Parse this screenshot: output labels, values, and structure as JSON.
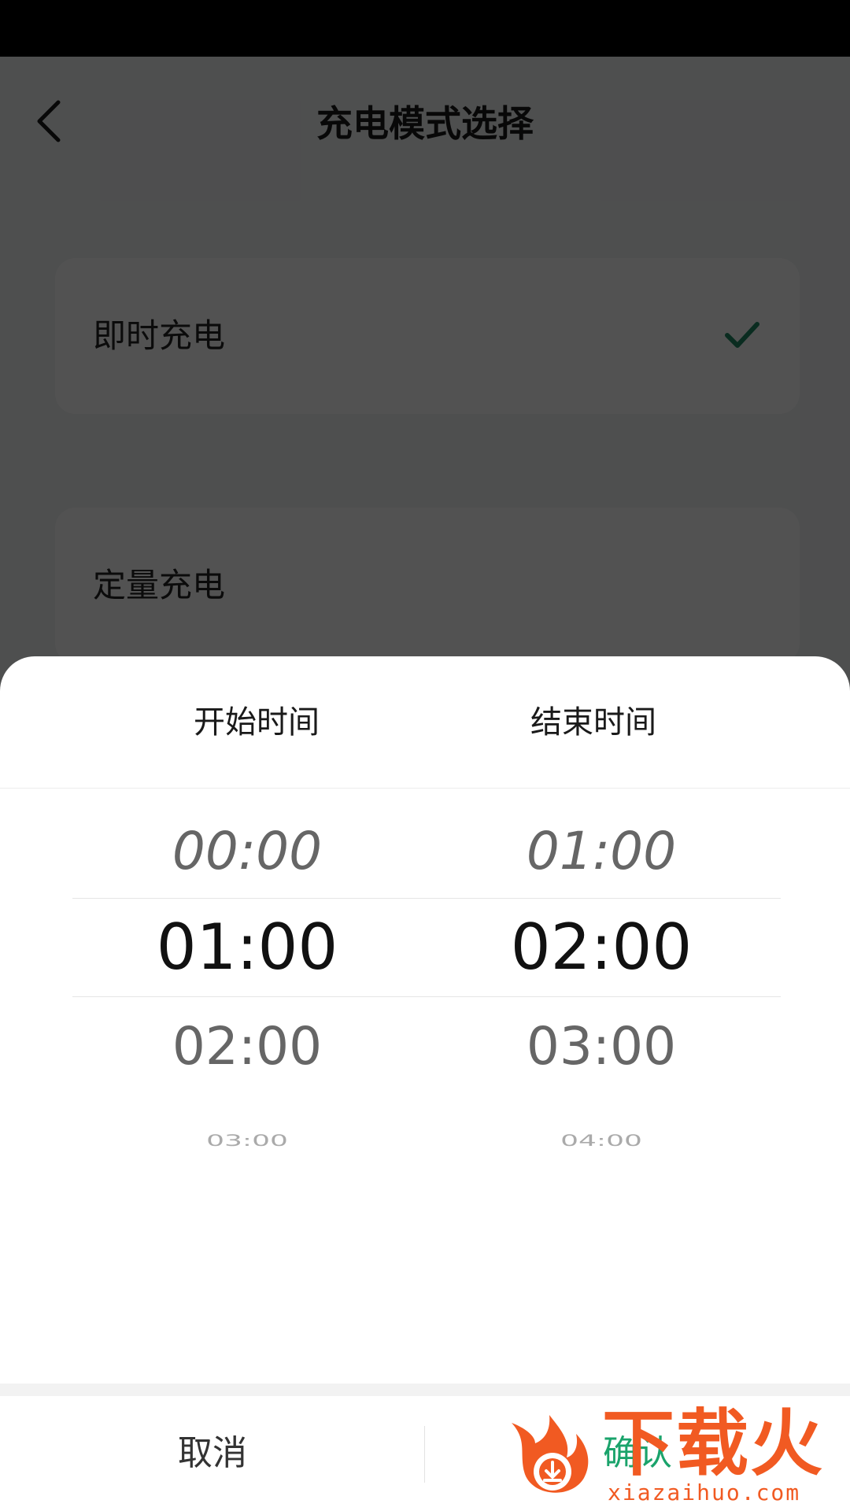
{
  "header": {
    "title": "充电模式选择"
  },
  "modes": [
    {
      "label": "即时充电",
      "selected": true
    },
    {
      "label": "定量充电",
      "selected": false
    }
  ],
  "picker": {
    "start_title": "开始时间",
    "end_title": "结束时间",
    "start_items": [
      "00:00",
      "01:00",
      "02:00",
      "03:00"
    ],
    "end_items": [
      "01:00",
      "02:00",
      "03:00",
      "04:00"
    ],
    "start_selected": "01:00",
    "end_selected": "02:00"
  },
  "actions": {
    "cancel_label": "取消",
    "confirm_label": "确认"
  },
  "watermark": {
    "brand": "下载火",
    "domain": "xiazaihuo.com"
  },
  "colors": {
    "accent": "#1aa36b",
    "check": "#1f8a63",
    "watermark": "#f15a22"
  }
}
